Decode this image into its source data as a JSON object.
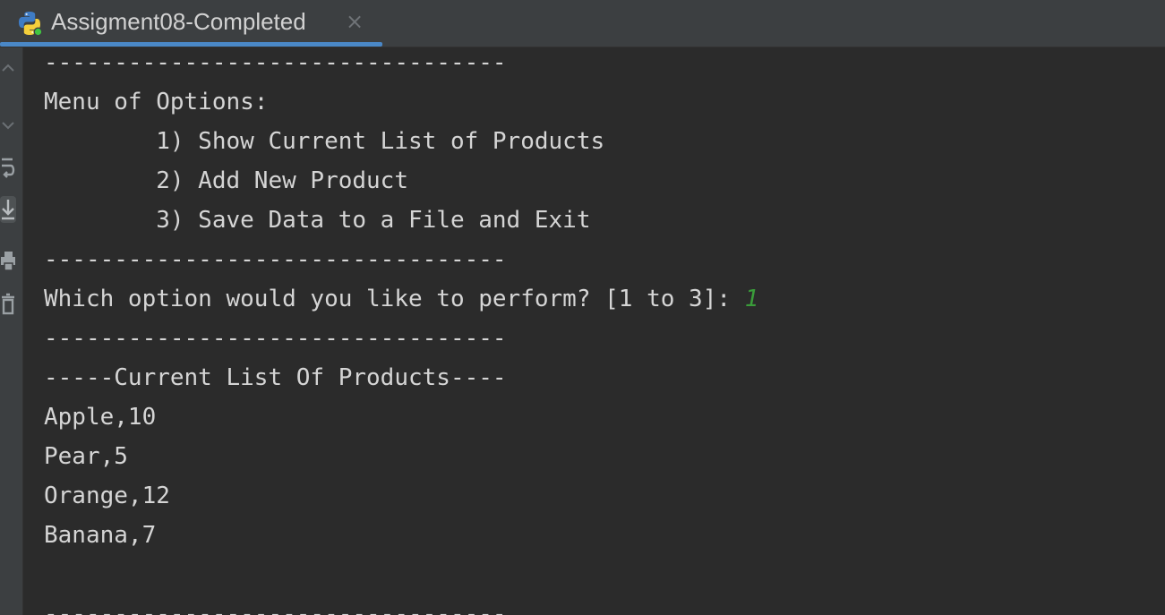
{
  "tab": {
    "title": "Assigment08-Completed",
    "close_glyph": "×",
    "icon": "python-icon",
    "accent": "#4a88c7"
  },
  "gutter": {
    "icons": [
      "scroll-up-icon",
      "scroll-down-icon",
      "soft-wrap-icon",
      "scroll-to-end-icon",
      "print-icon",
      "trash-icon"
    ]
  },
  "console": {
    "lines": [
      "---------------------------------",
      "Menu of Options:",
      "        1) Show Current List of Products",
      "        2) Add New Product",
      "        3) Save Data to a File and Exit",
      "---------------------------------",
      "Which option would you like to perform? [1 to 3]: ",
      "---------------------------------",
      "-----Current List Of Products----",
      "Apple,10",
      "Pear,5",
      "Orange,12",
      "Banana,7",
      "",
      "---------------------------------"
    ],
    "user_input": "1",
    "input_color": "#3a9c3a",
    "text_color": "#d5d5d5"
  }
}
